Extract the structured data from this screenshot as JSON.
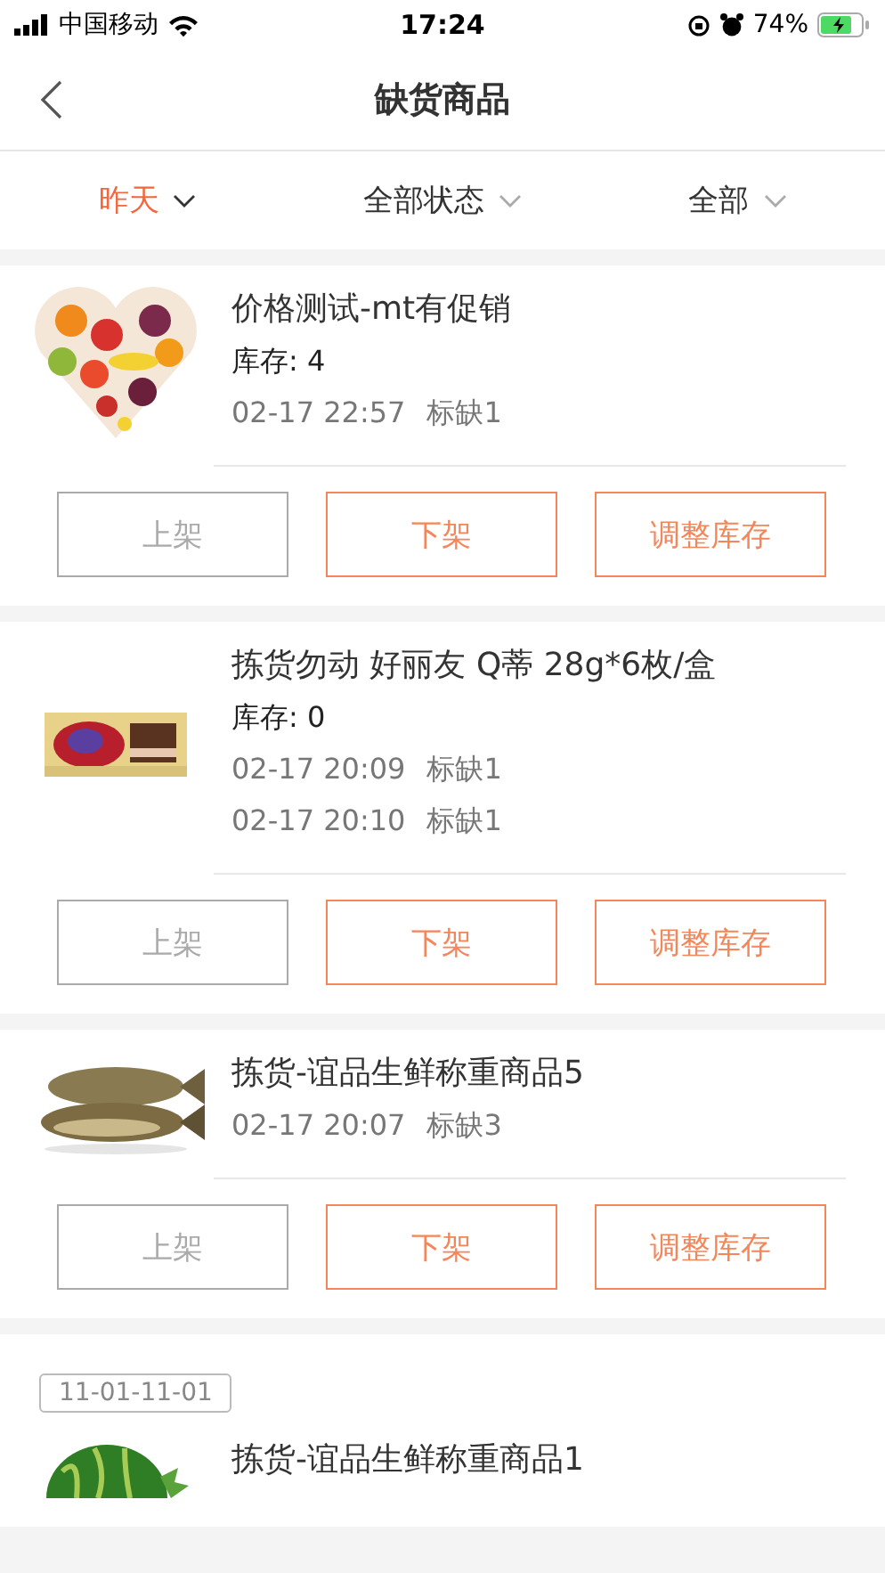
{
  "status_bar": {
    "carrier": "中国移动",
    "time": "17:24",
    "battery": "74%"
  },
  "nav": {
    "title": "缺货商品"
  },
  "filters": [
    {
      "label": "昨天",
      "selected": true
    },
    {
      "label": "全部状态",
      "selected": false
    },
    {
      "label": "全部",
      "selected": false
    }
  ],
  "products": [
    {
      "name": "价格测试-mt有促销",
      "stock": "库存: 4",
      "records": [
        {
          "time": "02-17 22:57",
          "mark": "标缺1"
        }
      ],
      "buttons": [
        {
          "label": "上架",
          "disabled": true
        },
        {
          "label": "下架",
          "disabled": false
        },
        {
          "label": "调整库存",
          "disabled": false
        }
      ]
    },
    {
      "name": "拣货勿动 好丽友 Q蒂 28g*6枚/盒",
      "stock": "库存: 0",
      "records": [
        {
          "time": "02-17 20:09",
          "mark": "标缺1"
        },
        {
          "time": "02-17 20:10",
          "mark": "标缺1"
        }
      ],
      "buttons": [
        {
          "label": "上架",
          "disabled": true
        },
        {
          "label": "下架",
          "disabled": false
        },
        {
          "label": "调整库存",
          "disabled": false
        }
      ]
    },
    {
      "name": "拣货-谊品生鲜称重商品5",
      "records": [
        {
          "time": "02-17 20:07",
          "mark": "标缺3"
        }
      ],
      "buttons": [
        {
          "label": "上架",
          "disabled": true
        },
        {
          "label": "下架",
          "disabled": false
        },
        {
          "label": "调整库存",
          "disabled": false
        }
      ]
    },
    {
      "tag": "11-01-11-01",
      "name": "拣货-谊品生鲜称重商品1"
    }
  ]
}
